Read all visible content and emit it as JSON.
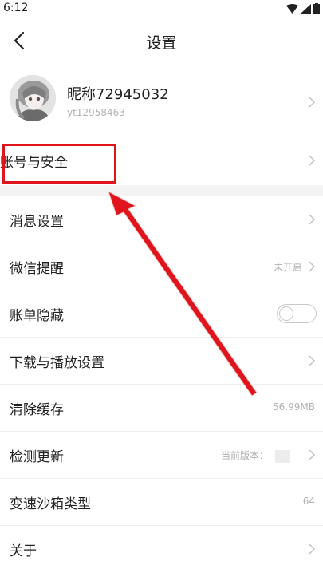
{
  "status_bar": {
    "time": "6:12"
  },
  "header": {
    "title": "设置"
  },
  "profile": {
    "nickname": "昵称72945032",
    "user_id": "yt12958463"
  },
  "settings": {
    "account_security": "账号与安全",
    "messages": "消息设置",
    "wechat_reminder": {
      "label": "微信提醒",
      "value": "未开启"
    },
    "hide_bills": {
      "label": "账单隐藏",
      "enabled": false
    },
    "download_playback": "下载与播放设置",
    "clear_cache": {
      "label": "清除缓存",
      "value": "56.99MB"
    },
    "check_update": {
      "label": "检测更新",
      "value": "当前版本："
    },
    "speed_sandbox": {
      "label": "变速沙箱类型",
      "value": "64"
    },
    "about": "关于"
  },
  "annotation": {
    "color": "#e0141c"
  }
}
